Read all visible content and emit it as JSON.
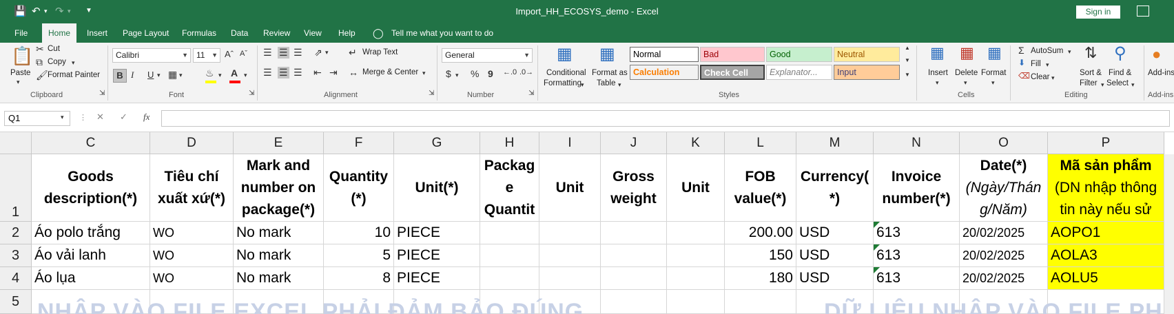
{
  "window": {
    "title": "Import_HH_ECOSYS_demo  -  Excel",
    "sign_in": "Sign in"
  },
  "quick_access": [
    "save-icon",
    "undo-icon",
    "redo-icon",
    "customize-icon"
  ],
  "tabs": [
    "File",
    "Home",
    "Insert",
    "Page Layout",
    "Formulas",
    "Data",
    "Review",
    "View",
    "Help"
  ],
  "tell_me": "Tell me what you want to do",
  "ribbon": {
    "clipboard": {
      "paste": "Paste",
      "cut": "Cut",
      "copy": "Copy",
      "format_painter": "Format Painter",
      "label": "Clipboard"
    },
    "font": {
      "family": "Calibri",
      "size": "11",
      "label": "Font",
      "bold": "B",
      "italic": "I",
      "underline": "U"
    },
    "alignment": {
      "wrap_text": "Wrap Text",
      "merge_center": "Merge & Center",
      "label": "Alignment"
    },
    "number": {
      "format": "General",
      "label": "Number",
      "currency": "$",
      "percent": "%",
      "comma": "9"
    },
    "styles": {
      "conditional": "Conditional Formatting",
      "cond_line1": "Conditional",
      "cond_line2": "Formatting",
      "format_table_line1": "Format as",
      "format_table_line2": "Table",
      "cells": [
        {
          "text": "Normal",
          "bg": "#ffffff",
          "color": "#000000"
        },
        {
          "text": "Bad",
          "bg": "#ffc7ce",
          "color": "#9c0006"
        },
        {
          "text": "Good",
          "bg": "#c6efce",
          "color": "#006100"
        },
        {
          "text": "Neutral",
          "bg": "#ffeb9c",
          "color": "#9c5700"
        },
        {
          "text": "Calculation",
          "bg": "#f2f2f2",
          "color": "#fa7d00"
        },
        {
          "text": "Check Cell",
          "bg": "#a5a5a5",
          "color": "#ffffff"
        },
        {
          "text": "Explanator...",
          "bg": "#ffffff",
          "color": "#7f7f7f"
        },
        {
          "text": "Input",
          "bg": "#ffcc99",
          "color": "#3f3f76"
        }
      ],
      "label": "Styles"
    },
    "cells": {
      "insert": "Insert",
      "delete": "Delete",
      "format": "Format",
      "label": "Cells"
    },
    "editing": {
      "autosum": "AutoSum",
      "fill": "Fill",
      "clear": "Clear",
      "sort_line1": "Sort &",
      "sort_line2": "Filter",
      "find_line1": "Find &",
      "find_line2": "Select",
      "label": "Editing"
    },
    "addins": {
      "text": "Add-ins",
      "label": "Add-ins"
    }
  },
  "formula_bar": {
    "name_box": "Q1",
    "value": ""
  },
  "columns": [
    "C",
    "D",
    "E",
    "F",
    "G",
    "H",
    "I",
    "J",
    "K",
    "L",
    "M",
    "N",
    "O",
    "P"
  ],
  "rows": [
    "1",
    "2",
    "3",
    "4",
    "5"
  ],
  "header_row": [
    [
      "Goods",
      "description(*)"
    ],
    [
      "Tiêu chí",
      "xuất xứ(*)"
    ],
    [
      "Mark and",
      "number on",
      "package(*)"
    ],
    [
      "Quantity",
      "(*)"
    ],
    [
      "Unit(*)"
    ],
    [
      "Packag",
      "e",
      "Quantit"
    ],
    [
      "Unit"
    ],
    [
      "Gross",
      "weight"
    ],
    [
      "Unit"
    ],
    [
      "FOB",
      "value(*)"
    ],
    [
      "Currency(",
      "*)"
    ],
    [
      "Invoice",
      "number(*)"
    ],
    [
      "Date(*)",
      "(Ngày/Thán",
      "g/Năm)"
    ],
    [
      "Mã sản phẩm",
      "(DN nhập thông",
      "tin này nếu sử"
    ]
  ],
  "data_rows": [
    [
      "Áo polo trắng",
      "WO",
      "No mark",
      "10",
      "PIECE",
      "",
      "",
      "",
      "",
      "200.00",
      "USD",
      "613",
      "20/02/2025",
      "AOPO1"
    ],
    [
      "Áo vải lanh",
      "WO",
      "No mark",
      "5",
      "PIECE",
      "",
      "",
      "",
      "",
      "150",
      "USD",
      "613",
      "20/02/2025",
      "AOLA3"
    ],
    [
      "Áo lụa",
      "WO",
      "No mark",
      "8",
      "PIECE",
      "",
      "",
      "",
      "",
      "180",
      "USD",
      "613",
      "20/02/2025",
      "AOLU5"
    ]
  ],
  "watermark_left": "NHẬP VÀO FILE EXCEL PHẢI ĐẢM BẢO ĐÚNG",
  "watermark_right": "DỮ LIỆU NHẬP VÀO FILE PHẢI"
}
